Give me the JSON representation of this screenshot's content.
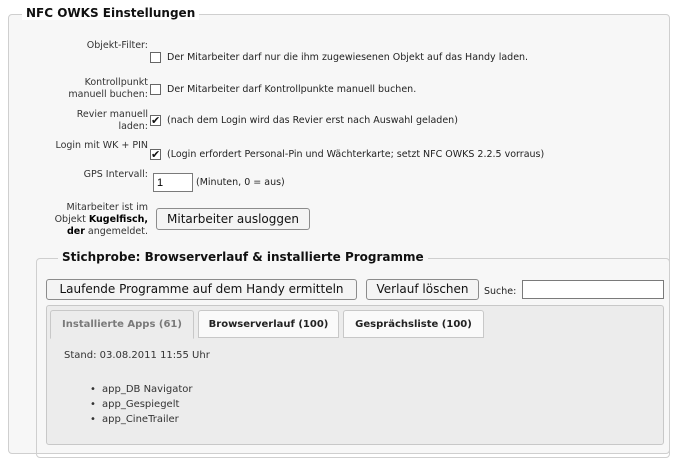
{
  "nfc_settings": {
    "legend": "NFC OWKS Einstellungen",
    "object_filter": {
      "label": "Objekt-Filter:",
      "checked": false,
      "text": "Der Mitarbeiter darf nur die ihm zugewiesenen Objekt auf das Handy laden."
    },
    "checkpoint_manual": {
      "label_line1": "Kontrollpunkt",
      "label_line2": "manuell buchen:",
      "checked": false,
      "text": "Der Mitarbeiter darf Kontrollpunkte manuell buchen."
    },
    "district_manual": {
      "label_line1": "Revier manuell",
      "label_line2": "laden:",
      "checked": true,
      "checkmark": "✔",
      "text": "(nach dem Login wird das Revier erst nach Auswahl geladen)"
    },
    "login_wk_pin": {
      "label": "Login mit WK + PIN",
      "checked": true,
      "checkmark": "✔",
      "text": "(Login erfordert Personal-Pin und Wächterkarte; setzt NFC OWKS 2.2.5 vorraus)"
    },
    "gps_interval": {
      "label": "GPS Intervall:",
      "value": "1",
      "hint": "(Minuten, 0 = aus)"
    },
    "employee_status": {
      "line1": "Mitarbeiter ist im",
      "line2_prefix": "Objekt ",
      "object_name": "Kugelfisch,",
      "line3_bold": "der",
      "line3_rest": " angemeldet.",
      "logout_button": "Mitarbeiter ausloggen"
    }
  },
  "sample": {
    "legend": "Stichprobe: Browserverlauf & installierte Programme",
    "running_programs_button": "Laufende Programme auf dem Handy ermitteln",
    "clear_history_button": "Verlauf löschen",
    "search_label": "Suche:",
    "search_value": "",
    "tabs": [
      {
        "label": "Installierte Apps (61)",
        "active": true
      },
      {
        "label": "Browserverlauf (100)",
        "active": false
      },
      {
        "label": "Gesprächsliste (100)",
        "active": false
      }
    ],
    "stand": "Stand: 03.08.2011 11:55 Uhr",
    "apps": [
      "app_DB Navigator",
      "app_Gespiegelt",
      "app_CineTrailer"
    ]
  },
  "colors": {
    "panel_bg": "#f7f7f7",
    "tab_panel_bg": "#ececec",
    "border": "#cfcfcf"
  }
}
